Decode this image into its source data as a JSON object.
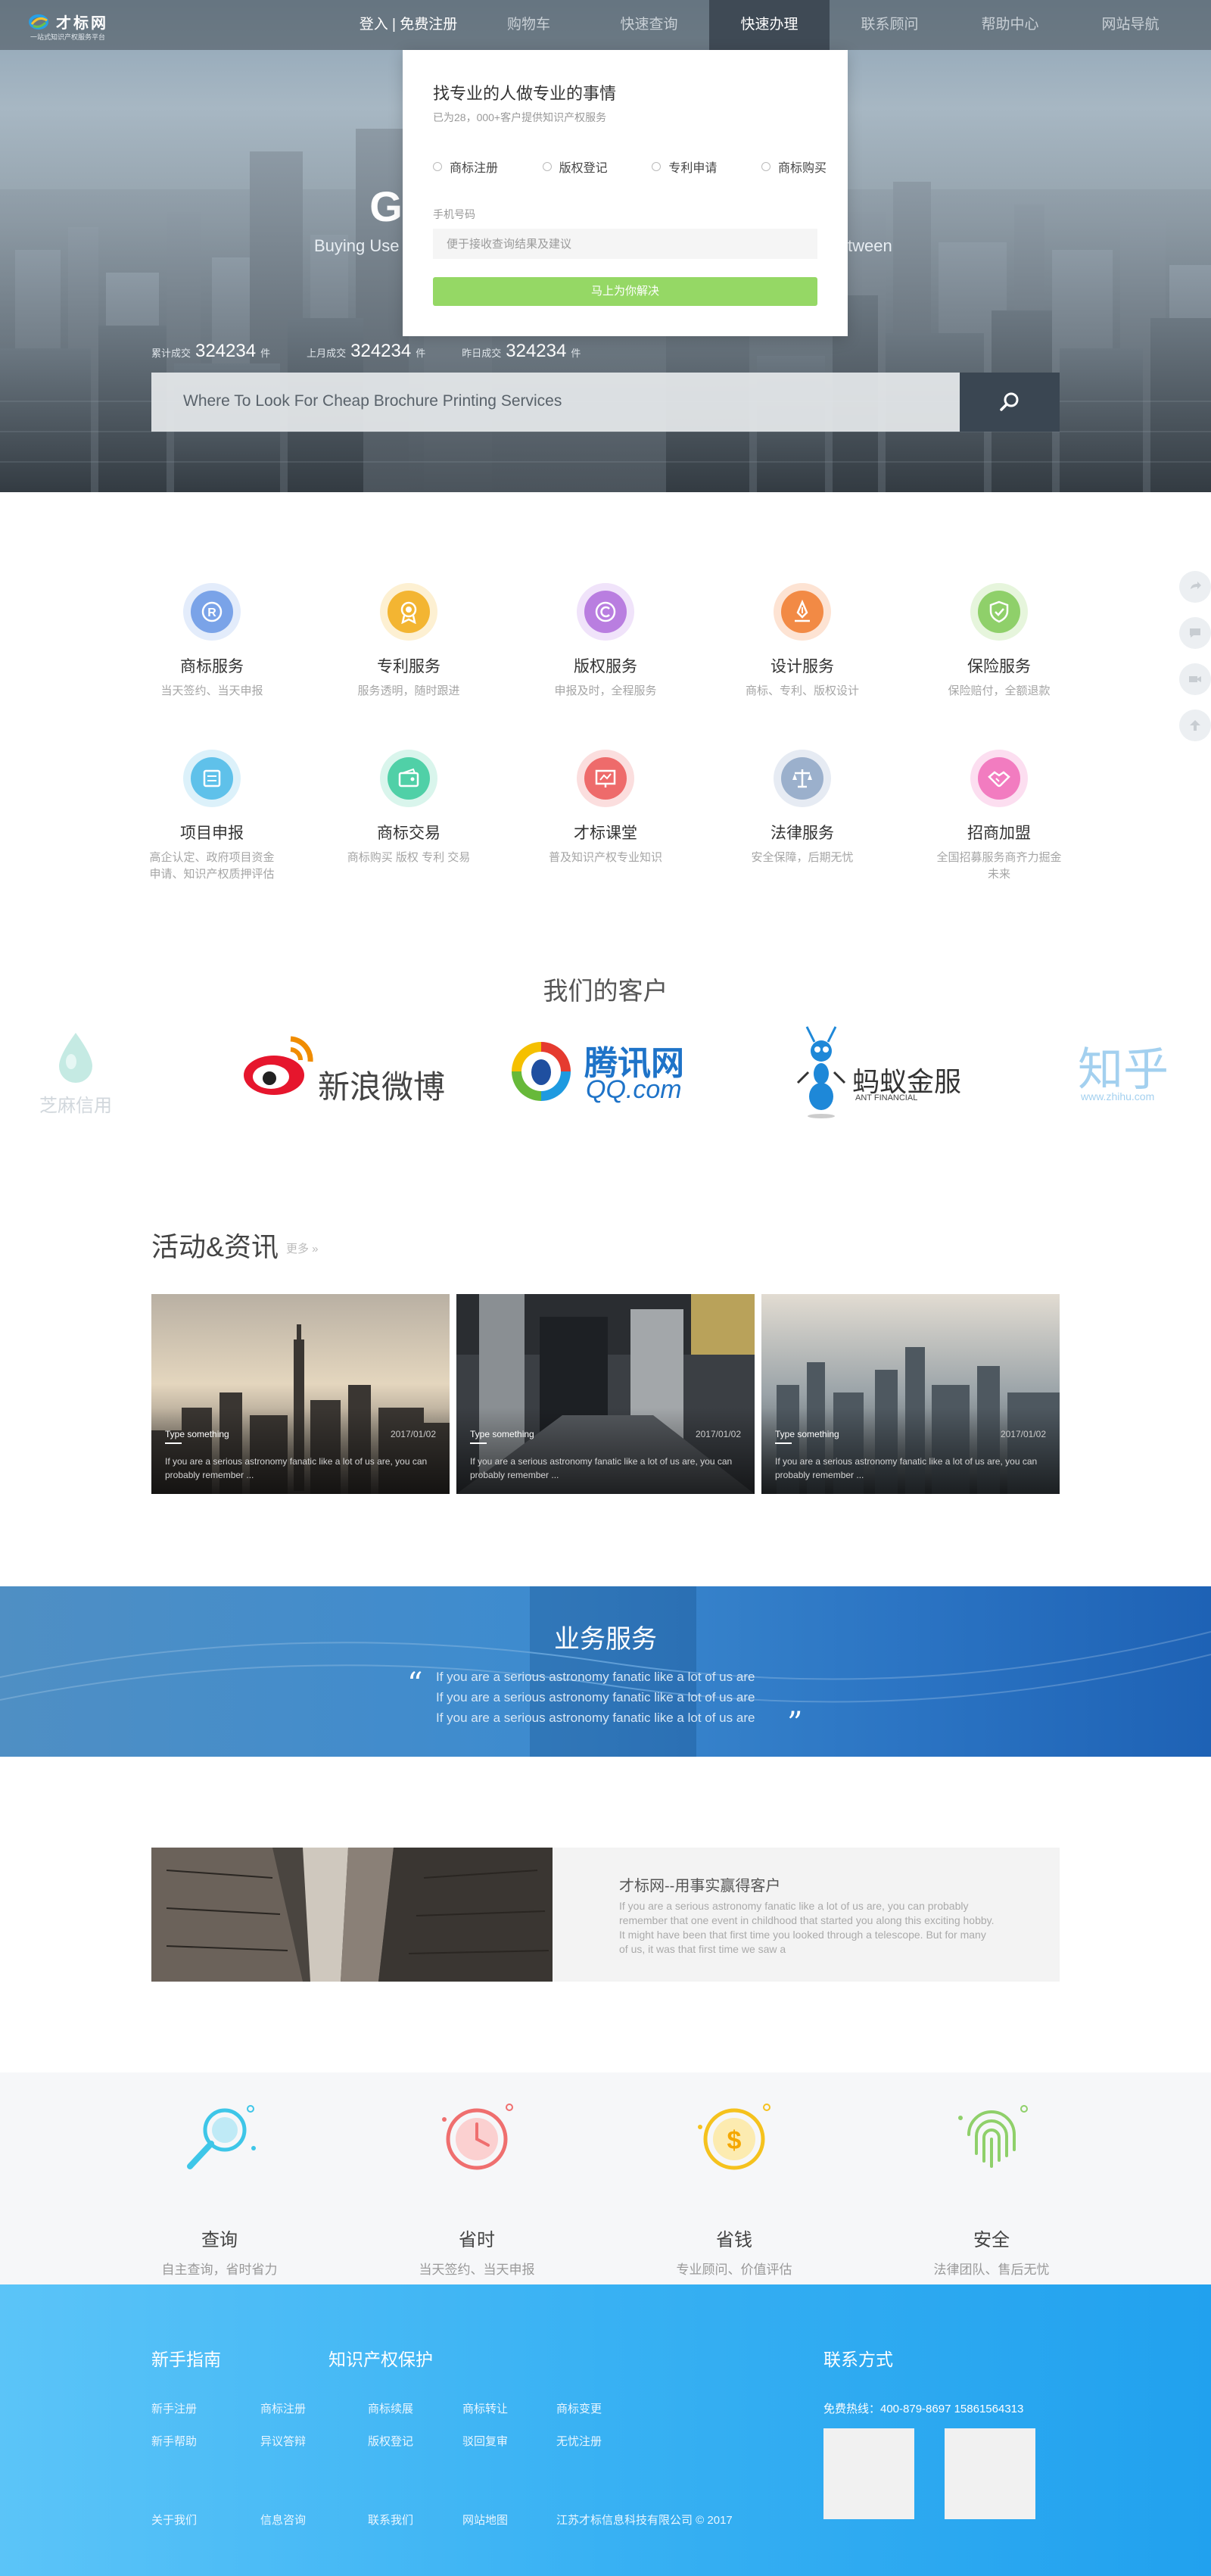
{
  "header": {
    "logo_name": "才标网",
    "logo_slogan": "一站式知识产权服务平台",
    "nav": [
      "登入 | 免费注册",
      "购物车",
      "快速查询",
      "快速办理",
      "联系顾问",
      "帮助中心",
      "网站导航"
    ],
    "active_nav": "快速办理"
  },
  "hero": {
    "title_visible": "G",
    "subtitle_left": "Buying Use",
    "subtitle_right": "tween",
    "stats": [
      {
        "label": "累计成交",
        "value": "324234",
        "unit": "件"
      },
      {
        "label": "上月成交",
        "value": "324234",
        "unit": "件"
      },
      {
        "label": "昨日成交",
        "value": "324234",
        "unit": "件"
      }
    ],
    "search_placeholder": "Where To Look For Cheap Brochure Printing Services"
  },
  "quick_form": {
    "title": "找专业的人做专业的事情",
    "subtitle": "已为28，000+客户提供知识产权服务",
    "options": [
      "商标注册",
      "版权登记",
      "专利申请",
      "商标购买"
    ],
    "phone_label": "手机号码",
    "phone_placeholder": "便于接收查询结果及建议",
    "submit_label": "马上为你解决"
  },
  "services": [
    {
      "title": "商标服务",
      "desc": "当天签约、当天申报",
      "color": "#7aa3e8",
      "icon": "trademark-r-icon"
    },
    {
      "title": "专利服务",
      "desc": "服务透明，随时跟进",
      "color": "#f3b532",
      "icon": "patent-medal-icon"
    },
    {
      "title": "版权服务",
      "desc": "申报及时，全程服务",
      "color": "#b97ee0",
      "icon": "copyright-icon"
    },
    {
      "title": "设计服务",
      "desc": "商标、专利、版权设计",
      "color": "#f28a45",
      "icon": "design-pen-icon"
    },
    {
      "title": "保险服务",
      "desc": "保险赔付，全额退款",
      "color": "#8fd06a",
      "icon": "insurance-shield-icon"
    },
    {
      "title": "项目申报",
      "desc": "高企认定、政府项目资金申请、知识产权质押评估",
      "color": "#5fc1ea",
      "icon": "project-doc-icon"
    },
    {
      "title": "商标交易",
      "desc": "商标购买 版权 专利 交易",
      "color": "#50d0a7",
      "icon": "trade-wallet-icon"
    },
    {
      "title": "才标课堂",
      "desc": "普及知识产权专业知识",
      "color": "#ee6b6b",
      "icon": "classroom-board-icon"
    },
    {
      "title": "法律服务",
      "desc": "安全保障，后期无忧",
      "color": "#9bb0cc",
      "icon": "law-scale-icon"
    },
    {
      "title": "招商加盟",
      "desc": "全国招募服务商齐力掘金未来",
      "color": "#f27cc0",
      "icon": "handshake-icon"
    }
  ],
  "clients": {
    "title": "我们的客户",
    "items": [
      {
        "name": "芝麻信用",
        "sub": ""
      },
      {
        "name": "新浪微博",
        "sub": ""
      },
      {
        "name": "腾讯网",
        "sub": "QQ.com"
      },
      {
        "name": "蚂蚁金服",
        "sub": "ANT FINANCIAL"
      },
      {
        "name": "知乎",
        "sub": "www.zhihu.com"
      }
    ]
  },
  "news": {
    "heading": "活动&资讯",
    "more": "更多 »",
    "cards": [
      {
        "title": "Type something",
        "date": "2017/01/02",
        "text": "If you are a serious astronomy fanatic like a lot of us are, you can probably remember ..."
      },
      {
        "title": "Type something",
        "date": "2017/01/02",
        "text": "If you are a serious astronomy fanatic like a lot of us are, you can probably remember ..."
      },
      {
        "title": "Type something",
        "date": "2017/01/02",
        "text": "If you are a serious astronomy fanatic like a lot of us are, you can probably remember ..."
      }
    ]
  },
  "business": {
    "title": "业务服务",
    "lines": [
      "If you are a serious astronomy fanatic like a lot of us are",
      "If you are a serious astronomy fanatic like a lot of us are",
      "If you are a serious astronomy fanatic like a lot of us are"
    ]
  },
  "feature": {
    "title": "才标网--用事实赢得客户",
    "text": "If you are a serious astronomy fanatic like a lot of us are, you can probably remember that one event in childhood that started you along this exciting hobby. It might have been that first time you looked through a telescope. But for many of us, it was that first time we saw a"
  },
  "advantages": [
    {
      "title": "查询",
      "desc": "自主查询，省时省力",
      "color": "#3ec6e8",
      "icon": "magnifier-icon"
    },
    {
      "title": "省时",
      "desc": "当天签约、当天申报",
      "color": "#ef6f6f",
      "icon": "clock-icon"
    },
    {
      "title": "省钱",
      "desc": "专业顾问、价值评估",
      "color": "#f5c21e",
      "icon": "coin-dollar-icon"
    },
    {
      "title": "安全",
      "desc": "法律团队、售后无忧",
      "color": "#8fd06a",
      "icon": "fingerprint-icon"
    }
  ],
  "footer": {
    "guide_title": "新手指南",
    "ip_title": "知识产权保护",
    "contact_title": "联系方式",
    "guide_links": [
      "新手注册",
      "商标注册",
      "新手帮助",
      "异议答辩"
    ],
    "ip_links": [
      "商标续展",
      "商标转让",
      "商标变更",
      "版权登记",
      "驳回复审",
      "无忧注册"
    ],
    "phone": "免费热线：400-879-8697    15861564313",
    "bottom_links": [
      "关于我们",
      "信息咨询",
      "联系我们",
      "网站地图"
    ],
    "copyright": "江苏才标信息科技有限公司 © 2017"
  },
  "colors": {
    "nav_active": "#3f4a55",
    "submit_green": "#95d865",
    "banner_blue": "#2b74c3",
    "footer_blue": "#38b1f3"
  }
}
